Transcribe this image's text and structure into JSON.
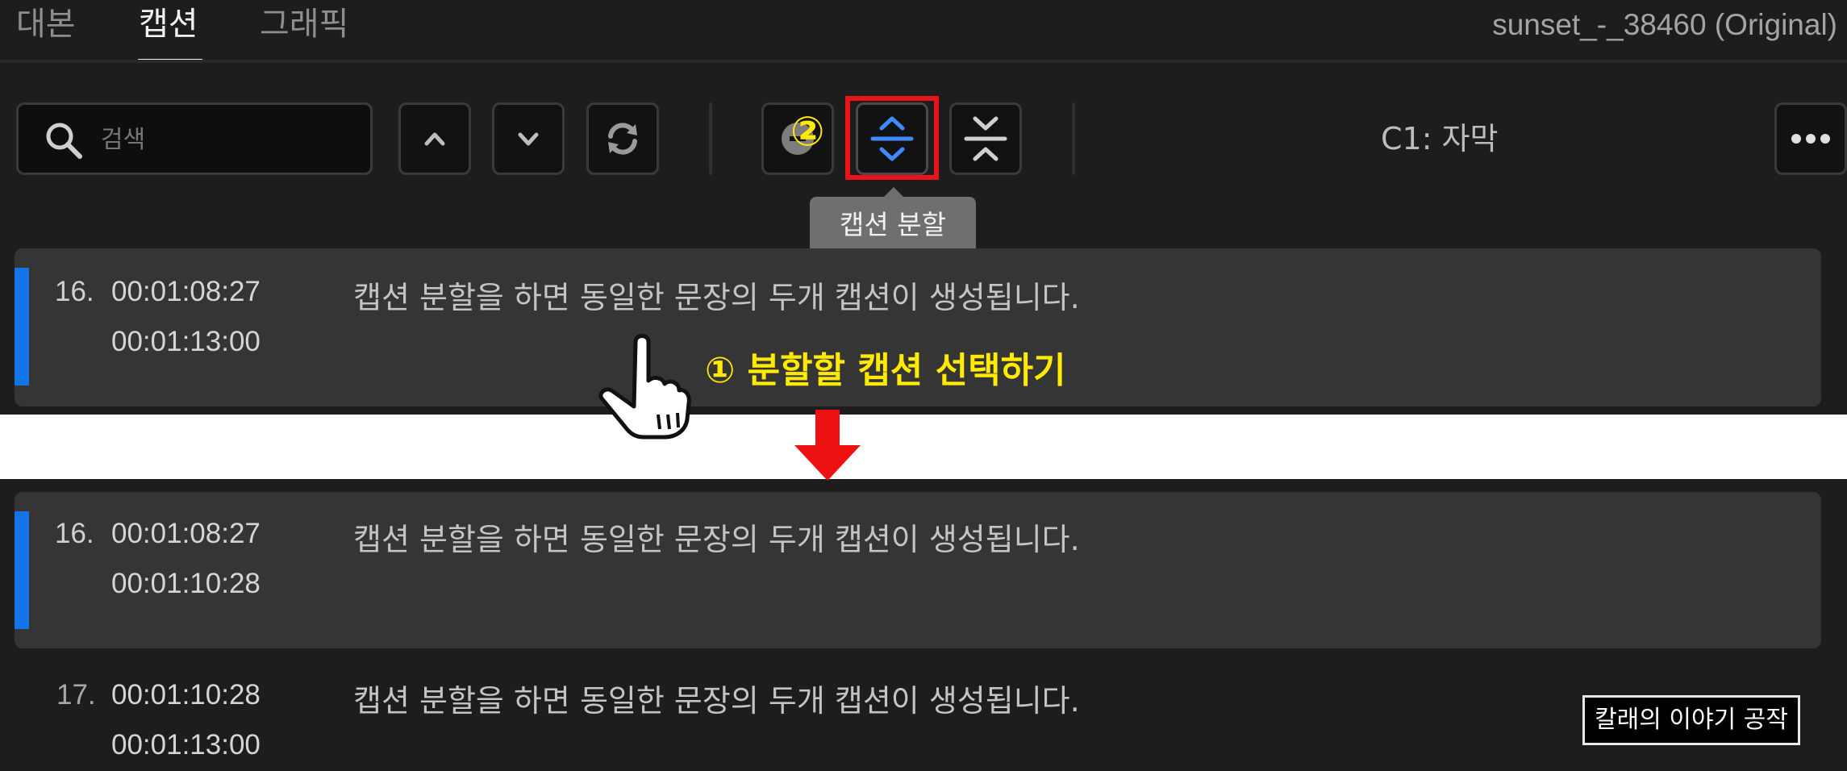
{
  "tabs": [
    {
      "label": "대본"
    },
    {
      "label": "캡션"
    },
    {
      "label": "그래픽"
    }
  ],
  "active_tab": "캡션",
  "project_name": "sunset_-_38460 (Original)",
  "search": {
    "placeholder": "검색",
    "value": ""
  },
  "toolbar": {
    "tooltip": "캡션 분할",
    "track_label": "C1: 자막",
    "accent_color": "#1473e6",
    "highlight_color": "#e8141a"
  },
  "annotations": {
    "step1": "① 분할할 캡션 선택하기",
    "step2": "②",
    "color": "#ffea00"
  },
  "before": {
    "captions": [
      {
        "index": "16.",
        "start": "00:01:08:27",
        "end": "00:01:13:00",
        "text": "캡션 분할을 하면 동일한 문장의 두개 캡션이 생성됩니다."
      }
    ]
  },
  "after": {
    "captions": [
      {
        "index": "16.",
        "start": "00:01:08:27",
        "end": "00:01:10:28",
        "text": "캡션 분할을 하면 동일한 문장의 두개 캡션이 생성됩니다."
      },
      {
        "index": "17.",
        "start": "00:01:10:28",
        "end": "00:01:13:00",
        "text": "캡션 분할을 하면 동일한 문장의 두개 캡션이 생성됩니다."
      }
    ]
  },
  "watermark": "칼래의 이야기 공작"
}
